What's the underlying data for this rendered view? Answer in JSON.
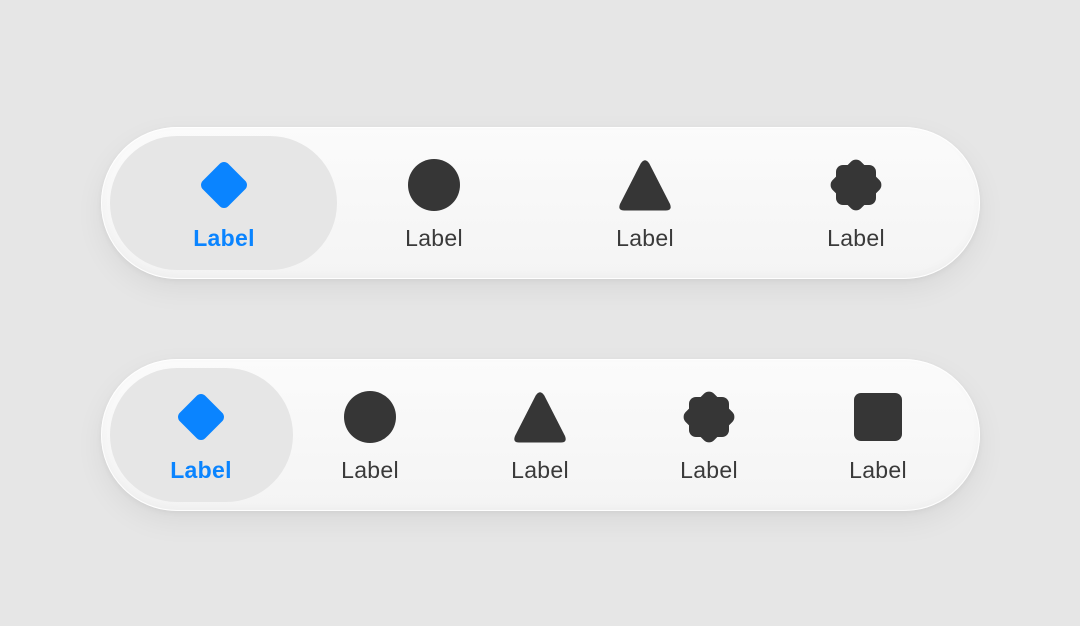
{
  "colors": {
    "accent": "#0a84ff",
    "icon": "#363636",
    "label": "#3a3a3a",
    "background": "#e6e6e6",
    "bar": "#f7f7f7",
    "selected_pill": "#e6e6e6"
  },
  "tab_bar_top": {
    "tabs": [
      {
        "label": "Label",
        "icon": "diamond-icon",
        "selected": true
      },
      {
        "label": "Label",
        "icon": "circle-icon",
        "selected": false
      },
      {
        "label": "Label",
        "icon": "triangle-icon",
        "selected": false
      },
      {
        "label": "Label",
        "icon": "badge-icon",
        "selected": false
      }
    ]
  },
  "tab_bar_bottom": {
    "tabs": [
      {
        "label": "Label",
        "icon": "diamond-icon",
        "selected": true
      },
      {
        "label": "Label",
        "icon": "circle-icon",
        "selected": false
      },
      {
        "label": "Label",
        "icon": "triangle-icon",
        "selected": false
      },
      {
        "label": "Label",
        "icon": "badge-icon",
        "selected": false
      },
      {
        "label": "Label",
        "icon": "square-icon",
        "selected": false
      }
    ]
  }
}
